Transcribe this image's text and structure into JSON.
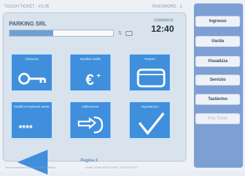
{
  "topbar": {
    "left": "TOUCH TICKET · V1.05",
    "right": "PASSWORD · 1"
  },
  "header": {
    "title": "PARKING SRL",
    "clock_label": "CORRENTE",
    "clock_time": "12:40",
    "progress": 0.42
  },
  "tiles": [
    {
      "label": "Chiavone",
      "icon": "key-icon"
    },
    {
      "label": "Modifica Tariffe",
      "icon": "euro-plus-icon"
    },
    {
      "label": "Tessere",
      "icon": "card-icon"
    },
    {
      "label": "Modifica Password utente",
      "icon": "password-icon"
    },
    {
      "label": "Calibrazione",
      "icon": "calibration-hand-icon"
    },
    {
      "label": "Impostazioni",
      "icon": "checkmark-icon"
    }
  ],
  "pager": {
    "label": "Pagina 2"
  },
  "footer": {
    "left": "Touch Interactive KC01 / Tel 0804848484",
    "right": "Serial: 00000-00000-0000 / CODICE 0001"
  },
  "sidebar": {
    "items": [
      {
        "label": "Ingresso",
        "enabled": true
      },
      {
        "label": "Uscita",
        "enabled": true
      },
      {
        "label": "Visualizza",
        "enabled": true
      },
      {
        "label": "Servizio",
        "enabled": true
      },
      {
        "label": "Tastierino",
        "enabled": true
      },
      {
        "label": "Pop Ticket",
        "enabled": false
      }
    ]
  },
  "colors": {
    "tile": "#3f8fdc",
    "rail": "#7d9fd4",
    "accent": "#6a8bbd"
  }
}
